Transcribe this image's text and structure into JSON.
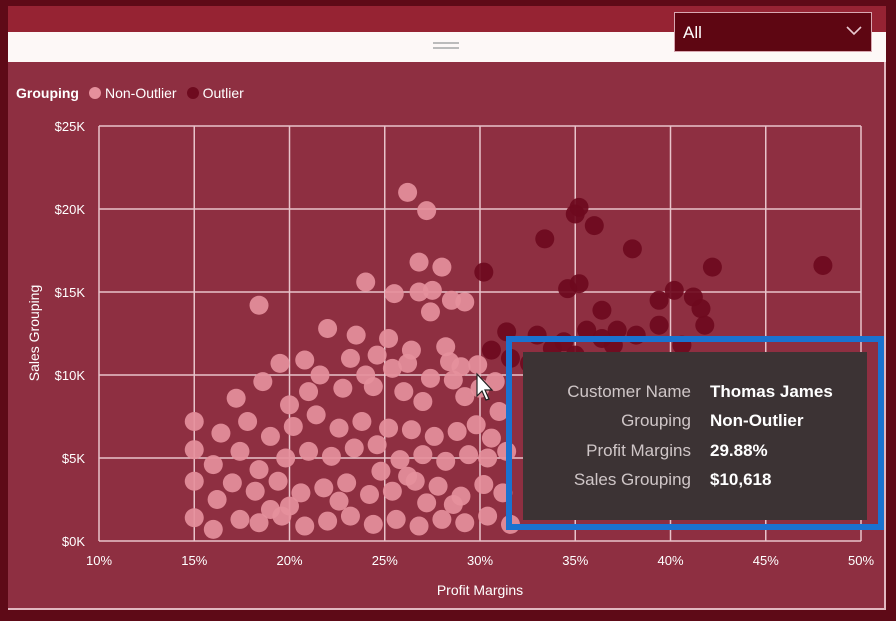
{
  "slicer": {
    "selected": "All",
    "icon": "chevron-down-icon"
  },
  "legend": {
    "title": "Grouping",
    "items": [
      {
        "label": "Non-Outlier",
        "color": "#e5909c"
      },
      {
        "label": "Outlier",
        "color": "#6e0a1e"
      }
    ]
  },
  "tooltip": {
    "rows": [
      {
        "key": "Customer Name",
        "value": "Thomas James"
      },
      {
        "key": "Grouping",
        "value": "Non-Outlier"
      },
      {
        "key": "Profit Margins",
        "value": "29.88%"
      },
      {
        "key": "Sales Grouping",
        "value": "$10,618"
      }
    ]
  },
  "colors": {
    "background": "#8e2f41",
    "frame": "#5e0a17",
    "highlight": "#1a72d0",
    "gridline": "#e8c3ca"
  },
  "chart_data": {
    "type": "scatter",
    "title": "",
    "xlabel": "Profit Margins",
    "ylabel": "Sales Grouping",
    "xlim": [
      10,
      50
    ],
    "ylim": [
      0,
      25000
    ],
    "x_ticks": [
      "10%",
      "15%",
      "20%",
      "25%",
      "30%",
      "35%",
      "40%",
      "45%",
      "50%"
    ],
    "y_ticks": [
      "$0K",
      "$5K",
      "$10K",
      "$15K",
      "$20K",
      "$25K"
    ],
    "grid": true,
    "legend_position": "top-left",
    "series": [
      {
        "name": "Non-Outlier",
        "color": "#e5909c",
        "points": [
          [
            26.2,
            21000
          ],
          [
            27.2,
            19900
          ],
          [
            18.4,
            14200
          ],
          [
            24.0,
            15600
          ],
          [
            25.5,
            14900
          ],
          [
            26.8,
            15000
          ],
          [
            28.0,
            16500
          ],
          [
            28.5,
            14500
          ],
          [
            26.8,
            16800
          ],
          [
            27.5,
            15100
          ],
          [
            29.2,
            14400
          ],
          [
            22.0,
            12800
          ],
          [
            23.5,
            12400
          ],
          [
            27.4,
            13800
          ],
          [
            25.2,
            12200
          ],
          [
            24.6,
            11200
          ],
          [
            26.4,
            11500
          ],
          [
            28.2,
            11700
          ],
          [
            29.0,
            10500
          ],
          [
            28.4,
            10800
          ],
          [
            19.5,
            10700
          ],
          [
            20.8,
            10900
          ],
          [
            21.6,
            10000
          ],
          [
            23.2,
            11000
          ],
          [
            24.0,
            10000
          ],
          [
            25.4,
            10400
          ],
          [
            26.2,
            10700
          ],
          [
            27.4,
            9800
          ],
          [
            28.6,
            9700
          ],
          [
            17.2,
            8600
          ],
          [
            18.6,
            9600
          ],
          [
            20.0,
            8200
          ],
          [
            21.0,
            9000
          ],
          [
            22.8,
            9200
          ],
          [
            24.4,
            9300
          ],
          [
            26.0,
            9000
          ],
          [
            27.0,
            8400
          ],
          [
            29.2,
            8700
          ],
          [
            30.0,
            9200
          ],
          [
            30.8,
            9600
          ],
          [
            15.0,
            7200
          ],
          [
            16.4,
            6500
          ],
          [
            17.8,
            7200
          ],
          [
            19.0,
            6300
          ],
          [
            20.2,
            6900
          ],
          [
            21.4,
            7600
          ],
          [
            22.6,
            6800
          ],
          [
            23.8,
            7200
          ],
          [
            25.2,
            6800
          ],
          [
            26.4,
            6700
          ],
          [
            27.6,
            6300
          ],
          [
            28.8,
            6600
          ],
          [
            29.8,
            7000
          ],
          [
            15.0,
            5500
          ],
          [
            16.0,
            4600
          ],
          [
            17.4,
            5400
          ],
          [
            18.4,
            4300
          ],
          [
            19.8,
            5000
          ],
          [
            21.0,
            5400
          ],
          [
            22.2,
            5100
          ],
          [
            23.4,
            5600
          ],
          [
            24.6,
            5800
          ],
          [
            25.8,
            4900
          ],
          [
            27.0,
            5200
          ],
          [
            28.2,
            4800
          ],
          [
            29.4,
            5200
          ],
          [
            30.4,
            5000
          ],
          [
            31.4,
            5400
          ],
          [
            15.0,
            3600
          ],
          [
            16.2,
            2500
          ],
          [
            17.0,
            3500
          ],
          [
            18.2,
            3000
          ],
          [
            19.4,
            3600
          ],
          [
            20.6,
            2900
          ],
          [
            21.8,
            3200
          ],
          [
            23.0,
            3500
          ],
          [
            24.2,
            2800
          ],
          [
            25.4,
            3000
          ],
          [
            26.6,
            3600
          ],
          [
            27.8,
            3300
          ],
          [
            29.0,
            2700
          ],
          [
            30.2,
            3400
          ],
          [
            31.2,
            2900
          ],
          [
            15.0,
            1400
          ],
          [
            16.0,
            700
          ],
          [
            17.4,
            1300
          ],
          [
            18.4,
            1100
          ],
          [
            19.6,
            1500
          ],
          [
            20.8,
            900
          ],
          [
            22.0,
            1200
          ],
          [
            23.2,
            1500
          ],
          [
            24.4,
            1000
          ],
          [
            25.6,
            1300
          ],
          [
            26.8,
            900
          ],
          [
            28.0,
            1300
          ],
          [
            29.2,
            1100
          ],
          [
            30.4,
            1500
          ],
          [
            31.6,
            1000
          ],
          [
            30.6,
            6200
          ],
          [
            31.0,
            7800
          ],
          [
            29.88,
            10618
          ],
          [
            24.8,
            4200
          ],
          [
            26.2,
            3900
          ],
          [
            27.2,
            2300
          ],
          [
            28.6,
            2200
          ],
          [
            22.6,
            2400
          ],
          [
            20.0,
            2100
          ],
          [
            19.0,
            1900
          ]
        ]
      },
      {
        "name": "Outlier",
        "color": "#6e0a1e",
        "points": [
          [
            35.0,
            19700
          ],
          [
            35.2,
            20100
          ],
          [
            36.0,
            19000
          ],
          [
            33.4,
            18200
          ],
          [
            38.0,
            17600
          ],
          [
            42.2,
            16500
          ],
          [
            48.0,
            16600
          ],
          [
            30.2,
            16200
          ],
          [
            35.2,
            15500
          ],
          [
            34.6,
            15200
          ],
          [
            36.4,
            13900
          ],
          [
            39.4,
            14500
          ],
          [
            40.2,
            15100
          ],
          [
            41.2,
            14700
          ],
          [
            41.6,
            14000
          ],
          [
            41.8,
            13000
          ],
          [
            31.4,
            12600
          ],
          [
            33.0,
            12400
          ],
          [
            34.4,
            12000
          ],
          [
            35.6,
            12700
          ],
          [
            36.4,
            12200
          ],
          [
            37.2,
            12700
          ],
          [
            38.2,
            12400
          ],
          [
            39.4,
            13000
          ],
          [
            30.6,
            11500
          ],
          [
            31.6,
            11000
          ],
          [
            32.6,
            10700
          ],
          [
            33.8,
            11600
          ],
          [
            35.0,
            11200
          ],
          [
            37.0,
            11800
          ],
          [
            40.6,
            11800
          ]
        ]
      }
    ],
    "highlighted_point": {
      "series": "Non-Outlier",
      "x": 29.88,
      "y": 10618
    }
  }
}
